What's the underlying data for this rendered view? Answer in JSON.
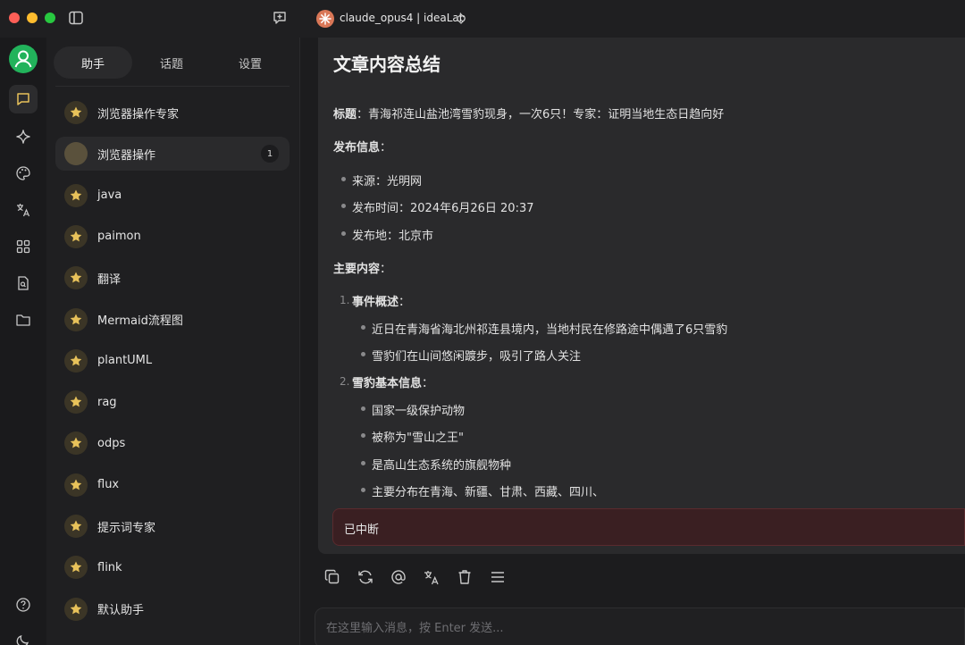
{
  "window": {
    "model_label": "claude_opus4 | ideaLab"
  },
  "sidebar": {
    "tabs": [
      {
        "label": "助手",
        "active": true
      },
      {
        "label": "话题",
        "active": false
      },
      {
        "label": "设置",
        "active": false
      }
    ],
    "assistants": [
      {
        "label": "浏览器操作专家",
        "icon": "star-icon"
      },
      {
        "label": "浏览器操作",
        "icon": "blank-avatar",
        "count": "1",
        "selected": true
      },
      {
        "label": "java",
        "icon": "star-icon"
      },
      {
        "label": "paimon",
        "icon": "star-icon"
      },
      {
        "label": "翻译",
        "icon": "star-icon"
      },
      {
        "label": "Mermaid流程图",
        "icon": "star-icon"
      },
      {
        "label": "plantUML",
        "icon": "star-icon"
      },
      {
        "label": "rag",
        "icon": "star-icon"
      },
      {
        "label": "odps",
        "icon": "star-icon"
      },
      {
        "label": "flux",
        "icon": "star-icon"
      },
      {
        "label": "提示词专家",
        "icon": "star-icon"
      },
      {
        "label": "flink",
        "icon": "star-icon"
      },
      {
        "label": "默认助手",
        "icon": "star-icon"
      }
    ]
  },
  "message": {
    "heading": "文章内容总结",
    "title_label": "标题",
    "title_value": "：青海祁连山盐池湾雪豹现身，一次6只！专家：证明当地生态日趋向好",
    "publish_heading": "发布信息",
    "colon": "：",
    "publish_items": [
      "来源：光明网",
      "发布时间：2024年6月26日 20:37",
      "发布地：北京市"
    ],
    "main_heading": "主要内容",
    "sections": [
      {
        "num": "1.",
        "title": "事件概述",
        "items": [
          "近日在青海省海北州祁连县境内，当地村民在修路途中偶遇了6只雪豹",
          "雪豹们在山间悠闲踱步，吸引了路人关注"
        ]
      },
      {
        "num": "2.",
        "title": "雪豹基本信息",
        "items": [
          "国家一级保护动物",
          "被称为\"雪山之王\"",
          "是高山生态系统的旗舰物种",
          "主要分布在青海、新疆、甘肃、西藏、四川、"
        ]
      }
    ],
    "interrupted": "已中断"
  },
  "input": {
    "placeholder": "在这里输入消息，按 Enter 发送..."
  },
  "colors": {
    "accent_green": "#22b35b",
    "star_gold": "#e8c25a",
    "interrupt_bg": "#3a1f22"
  }
}
